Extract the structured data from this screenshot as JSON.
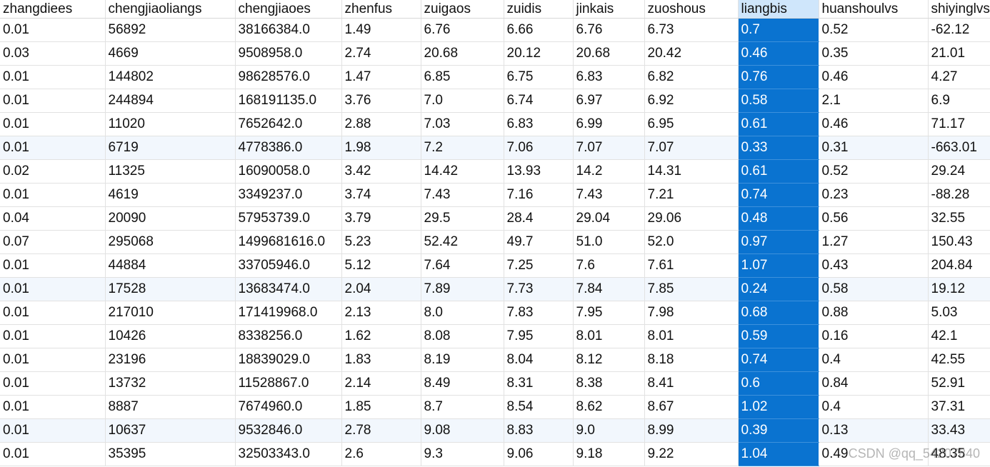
{
  "columns": [
    "zhangdiees",
    "chengjiaoliangs",
    "chengjiaoes",
    "zhenfus",
    "zuigaos",
    "zuidis",
    "jinkais",
    "zuoshous",
    "liangbis",
    "huanshoulvs",
    "shiyinglvs"
  ],
  "selected_column_index": 8,
  "selection_color": "#0a73d0",
  "rows": [
    [
      "0.01",
      "56892",
      "38166384.0",
      "1.49",
      "6.76",
      "6.66",
      "6.76",
      "6.73",
      "0.7",
      "0.52",
      "-62.12"
    ],
    [
      "0.03",
      "4669",
      "9508958.0",
      "2.74",
      "20.68",
      "20.12",
      "20.68",
      "20.42",
      "0.46",
      "0.35",
      "21.01"
    ],
    [
      "0.01",
      "144802",
      "98628576.0",
      "1.47",
      "6.85",
      "6.75",
      "6.83",
      "6.82",
      "0.76",
      "0.46",
      "4.27"
    ],
    [
      "0.01",
      "244894",
      "168191135.0",
      "3.76",
      "7.0",
      "6.74",
      "6.97",
      "6.92",
      "0.58",
      "2.1",
      "6.9"
    ],
    [
      "0.01",
      "11020",
      "7652642.0",
      "2.88",
      "7.03",
      "6.83",
      "6.99",
      "6.95",
      "0.61",
      "0.46",
      "71.17"
    ],
    [
      "0.01",
      "6719",
      "4778386.0",
      "1.98",
      "7.2",
      "7.06",
      "7.07",
      "7.07",
      "0.33",
      "0.31",
      "-663.01"
    ],
    [
      "0.02",
      "11325",
      "16090058.0",
      "3.42",
      "14.42",
      "13.93",
      "14.2",
      "14.31",
      "0.61",
      "0.52",
      "29.24"
    ],
    [
      "0.01",
      "4619",
      "3349237.0",
      "3.74",
      "7.43",
      "7.16",
      "7.43",
      "7.21",
      "0.74",
      "0.23",
      "-88.28"
    ],
    [
      "0.04",
      "20090",
      "57953739.0",
      "3.79",
      "29.5",
      "28.4",
      "29.04",
      "29.06",
      "0.48",
      "0.56",
      "32.55"
    ],
    [
      "0.07",
      "295068",
      "1499681616.0",
      "5.23",
      "52.42",
      "49.7",
      "51.0",
      "52.0",
      "0.97",
      "1.27",
      "150.43"
    ],
    [
      "0.01",
      "44884",
      "33705946.0",
      "5.12",
      "7.64",
      "7.25",
      "7.6",
      "7.61",
      "1.07",
      "0.43",
      "204.84"
    ],
    [
      "0.01",
      "17528",
      "13683474.0",
      "2.04",
      "7.89",
      "7.73",
      "7.84",
      "7.85",
      "0.24",
      "0.58",
      "19.12"
    ],
    [
      "0.01",
      "217010",
      "171419968.0",
      "2.13",
      "8.0",
      "7.83",
      "7.95",
      "7.98",
      "0.68",
      "0.88",
      "5.03"
    ],
    [
      "0.01",
      "10426",
      "8338256.0",
      "1.62",
      "8.08",
      "7.95",
      "8.01",
      "8.01",
      "0.59",
      "0.16",
      "42.1"
    ],
    [
      "0.01",
      "23196",
      "18839029.0",
      "1.83",
      "8.19",
      "8.04",
      "8.12",
      "8.18",
      "0.74",
      "0.4",
      "42.55"
    ],
    [
      "0.01",
      "13732",
      "11528867.0",
      "2.14",
      "8.49",
      "8.31",
      "8.38",
      "8.41",
      "0.6",
      "0.84",
      "52.91"
    ],
    [
      "0.01",
      "8887",
      "7674960.0",
      "1.85",
      "8.7",
      "8.54",
      "8.62",
      "8.67",
      "1.02",
      "0.4",
      "37.31"
    ],
    [
      "0.01",
      "10637",
      "9532846.0",
      "2.78",
      "9.08",
      "8.83",
      "9.0",
      "8.99",
      "0.39",
      "0.13",
      "33.43"
    ],
    [
      "0.01",
      "35395",
      "32503343.0",
      "2.6",
      "9.3",
      "9.06",
      "9.18",
      "9.22",
      "1.04",
      "0.49",
      "48.35"
    ]
  ],
  "alt_rows": [
    5,
    11,
    17
  ],
  "watermark": "CSDN @qq_54207840"
}
